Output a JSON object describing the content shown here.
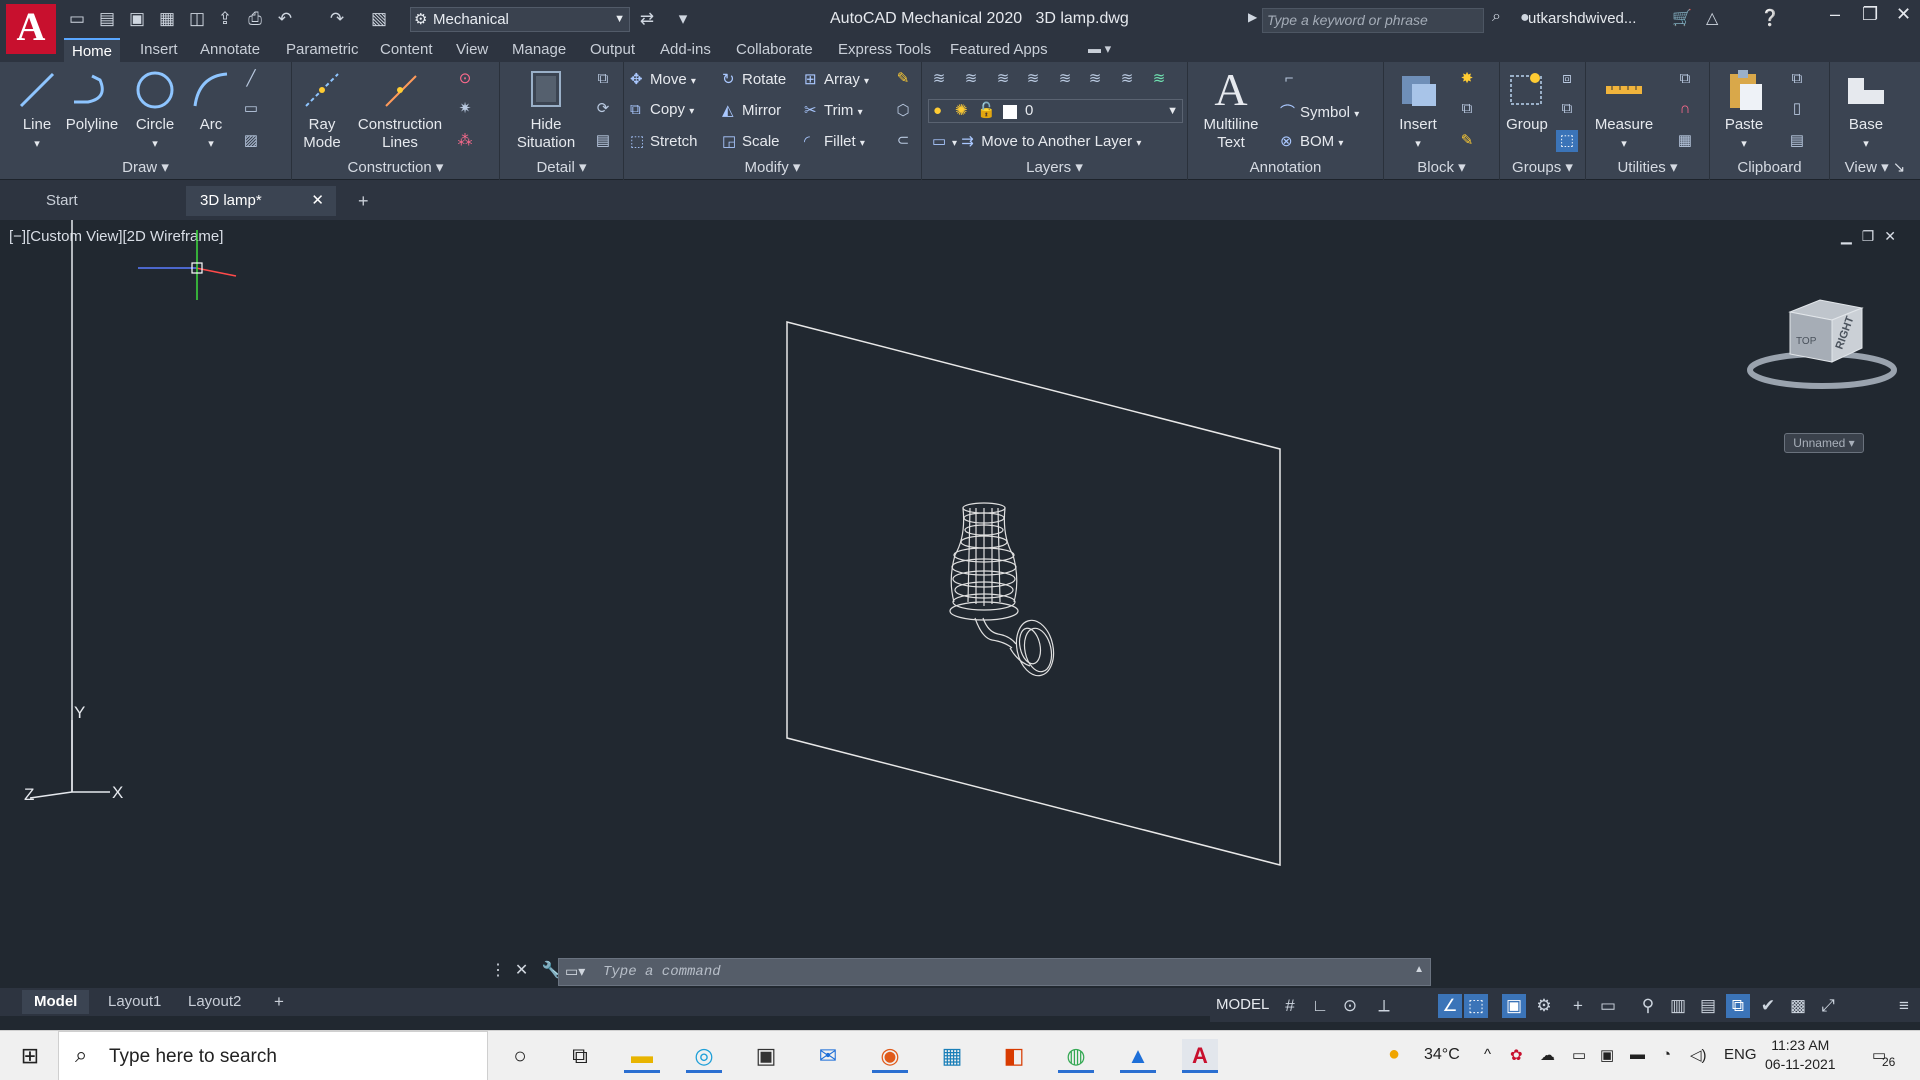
{
  "titlebar": {
    "workspace": "Mechanical",
    "app_title": "AutoCAD Mechanical 2020",
    "file_title": "3D lamp.dwg",
    "search_placeholder": "Type a keyword or phrase",
    "user": "utkarshdwived..."
  },
  "ribbon_tabs": [
    "Home",
    "Insert",
    "Annotate",
    "Parametric",
    "Content",
    "View",
    "Manage",
    "Output",
    "Add-ins",
    "Collaborate",
    "Express Tools",
    "Featured Apps"
  ],
  "panels": {
    "draw": {
      "title": "Draw",
      "line": "Line",
      "polyline": "Polyline",
      "circle": "Circle",
      "arc": "Arc"
    },
    "construction": {
      "title": "Construction",
      "ray1": "Ray",
      "ray2": "Mode",
      "cons1": "Construction",
      "cons2": "Lines"
    },
    "detail": {
      "title": "Detail",
      "hide1": "Hide",
      "hide2": "Situation"
    },
    "modify": {
      "title": "Modify",
      "move": "Move",
      "rotate": "Rotate",
      "array": "Array",
      "copy": "Copy",
      "mirror": "Mirror",
      "trim": "Trim",
      "stretch": "Stretch",
      "scale": "Scale",
      "fillet": "Fillet"
    },
    "layers": {
      "title": "Layers",
      "current_layer": "0",
      "move_to_layer": "Move to Another Layer"
    },
    "annotation": {
      "title": "Annotation",
      "mtext1": "Multiline",
      "mtext2": "Text",
      "symbol": "Symbol",
      "bom": "BOM"
    },
    "block": {
      "title": "Block",
      "insert": "Insert"
    },
    "groups": {
      "title": "Groups",
      "group": "Group"
    },
    "utilities": {
      "title": "Utilities",
      "measure": "Measure"
    },
    "clipboard": {
      "title": "Clipboard",
      "paste": "Paste"
    },
    "view": {
      "title": "View",
      "base": "Base"
    }
  },
  "file_tabs": {
    "start": "Start",
    "active": "3D lamp*"
  },
  "viewport": {
    "label": "[−][Custom View][2D Wireframe]",
    "viewcube_top": "TOP",
    "viewcube_right": "RIGHT",
    "ucs_name": "Unnamed",
    "axis_x": "X",
    "axis_y": "Y",
    "axis_z": "Z"
  },
  "command": {
    "placeholder": "Type a command"
  },
  "layout_tabs": [
    "Model",
    "Layout1",
    "Layout2"
  ],
  "status": {
    "model": "MODEL"
  },
  "taskbar": {
    "search_placeholder": "Type here to search",
    "temperature": "34°C",
    "language": "ENG",
    "time": "11:23 AM",
    "date": "06-11-2021",
    "notifications": "26"
  }
}
